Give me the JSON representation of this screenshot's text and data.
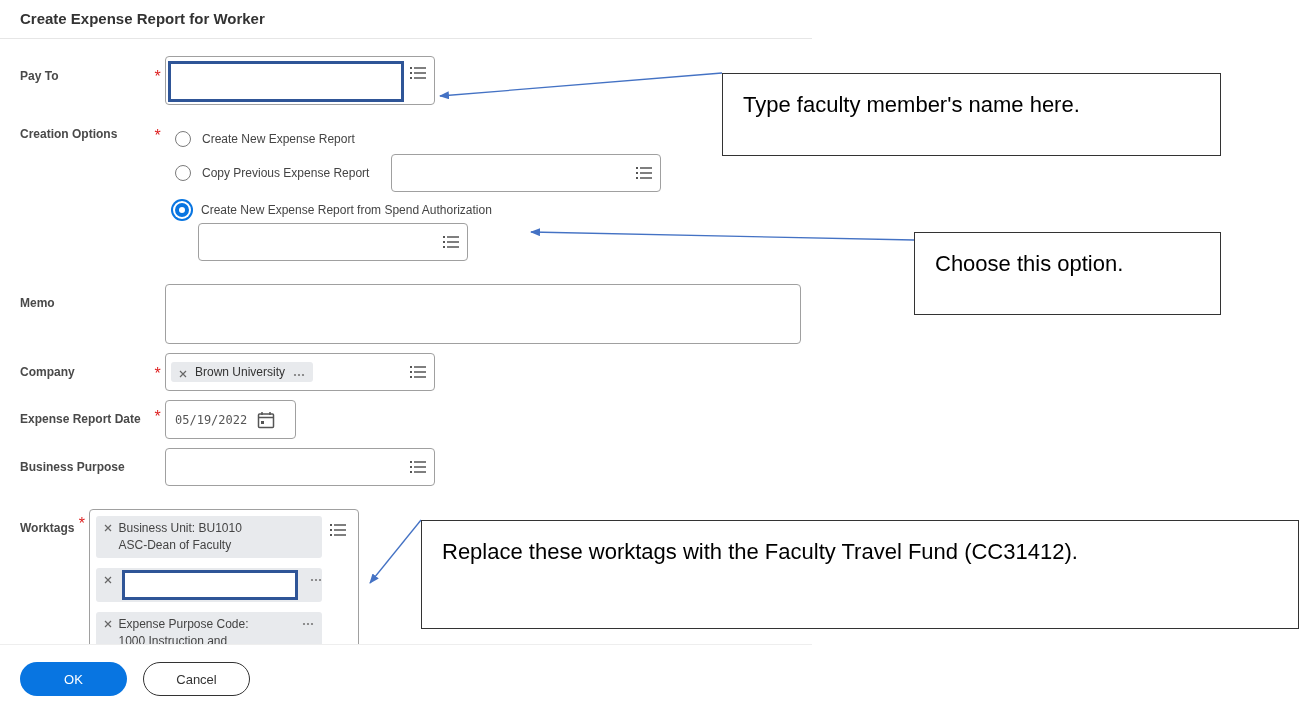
{
  "title": "Create Expense Report for Worker",
  "fields": [
    {
      "kind": "prompt",
      "label": "Pay To",
      "required_mark": "*",
      "redacted": true
    },
    {
      "kind": "radios",
      "label": "Creation Options",
      "required_mark": "*",
      "options": [
        {
          "label": "Create New Expense Report",
          "selected": false,
          "kind": "plain"
        },
        {
          "label": "Copy Previous Expense Report",
          "selected": false,
          "kind": "inline-field"
        },
        {
          "label": "Create New Expense Report from Spend Authorization",
          "selected": true,
          "kind": "field-below"
        }
      ]
    },
    {
      "kind": "textarea",
      "label": "Memo"
    },
    {
      "kind": "prompt",
      "label": "Company",
      "required_mark": "*",
      "chips": [
        {
          "text": "Brown University"
        }
      ]
    },
    {
      "kind": "date",
      "label": "Expense Report Date",
      "required_mark": "*",
      "value": "05/19/2022"
    },
    {
      "kind": "prompt",
      "label": "Business Purpose"
    },
    {
      "kind": "tags",
      "label": "Worktags",
      "required_mark": "*",
      "chips": [
        {
          "text": "Business Unit: BU1010 ASC-Dean of Faculty"
        },
        {
          "redacted": true
        },
        {
          "text": "Expense Purpose Code: 1000 Instruction and"
        }
      ]
    }
  ],
  "buttons": [
    {
      "label": "OK",
      "kind": "primary"
    },
    {
      "label": "Cancel",
      "kind": "secondary"
    }
  ],
  "callouts": [
    {
      "text": "Type faculty member's name here."
    },
    {
      "text": "Choose this option."
    },
    {
      "text": "Replace these worktags with the Faculty Travel Fund (CC31412)."
    }
  ]
}
